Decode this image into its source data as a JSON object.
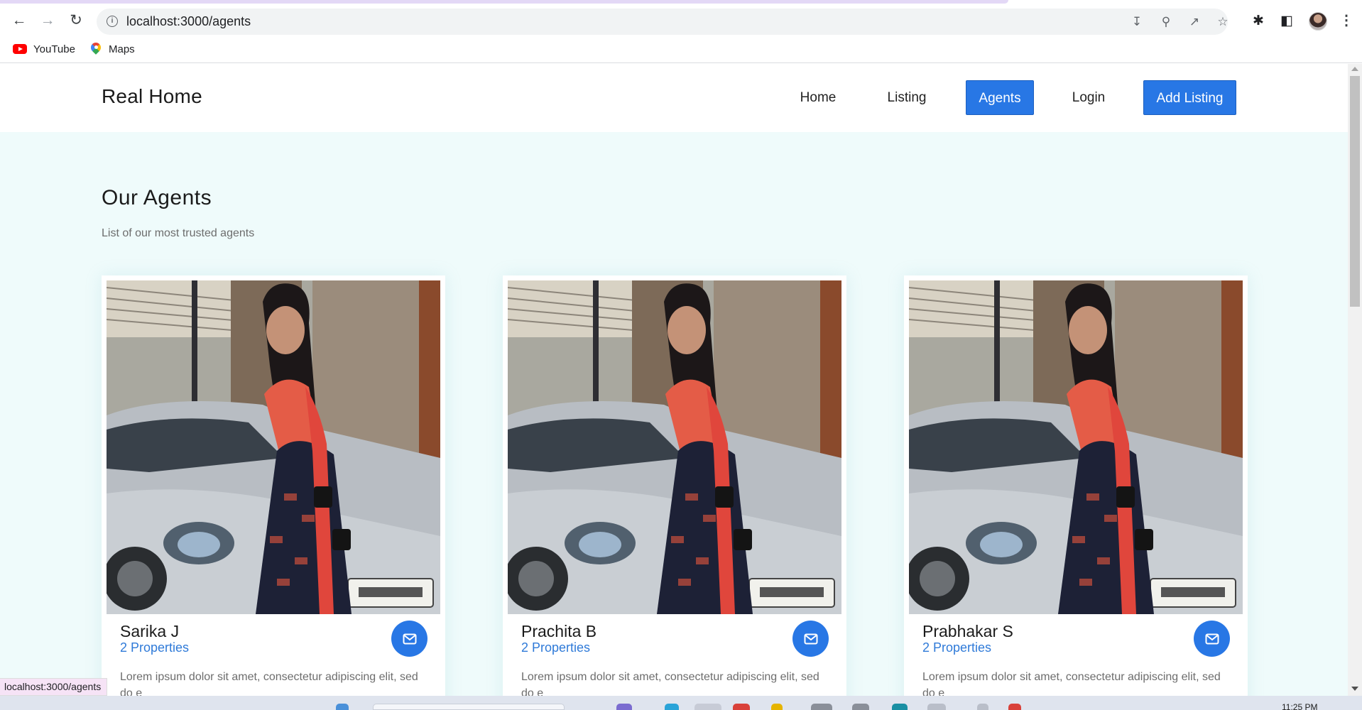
{
  "browser": {
    "url": "localhost:3000/agents",
    "bookmarks": [
      {
        "label": "YouTube",
        "icon": "youtube-icon"
      },
      {
        "label": "Maps",
        "icon": "maps-icon"
      }
    ],
    "status_url": "localhost:3000/agents"
  },
  "site": {
    "brand": "Real Home",
    "nav": [
      "Home",
      "Listing",
      "Agents",
      "Login"
    ],
    "active_nav": "Agents",
    "cta": "Add Listing",
    "accent_color": "#2877e5"
  },
  "section": {
    "title": "Our Agents",
    "subtitle": "List of our most trusted agents"
  },
  "agents": [
    {
      "name": "Sarika J",
      "properties": "2 Properties",
      "description": "Lorem ipsum dolor sit amet, consectetur adipiscing elit, sed do e"
    },
    {
      "name": "Prachita B",
      "properties": "2 Properties",
      "description": "Lorem ipsum dolor sit amet, consectetur adipiscing elit, sed do e"
    },
    {
      "name": "Prabhakar S",
      "properties": "2 Properties",
      "description": "Lorem ipsum dolor sit amet, consectetur adipiscing elit, sed do e"
    }
  ],
  "taskbar": {
    "clock": "11:25 PM"
  }
}
